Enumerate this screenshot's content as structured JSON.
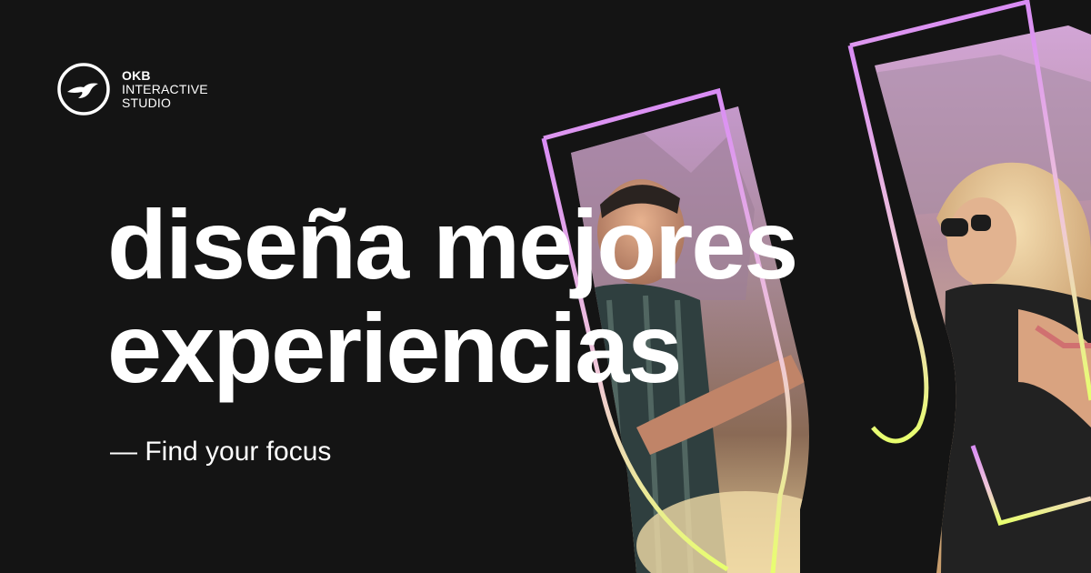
{
  "brand": {
    "name_line1": "OKB",
    "name_line2": "INTERACTIVE",
    "name_line3": "STUDIO",
    "logo_icon": "bird-in-circle-icon"
  },
  "hero": {
    "headline_line1": "diseña mejores",
    "headline_line2": "experiencias",
    "tagline": "— Find your focus"
  },
  "artwork": {
    "photo_description_icon": "people-celebrating-photo",
    "outline_gradient": [
      "#d98cf5",
      "#f2c2d9",
      "#e8ff72"
    ],
    "background_color": "#141414"
  }
}
